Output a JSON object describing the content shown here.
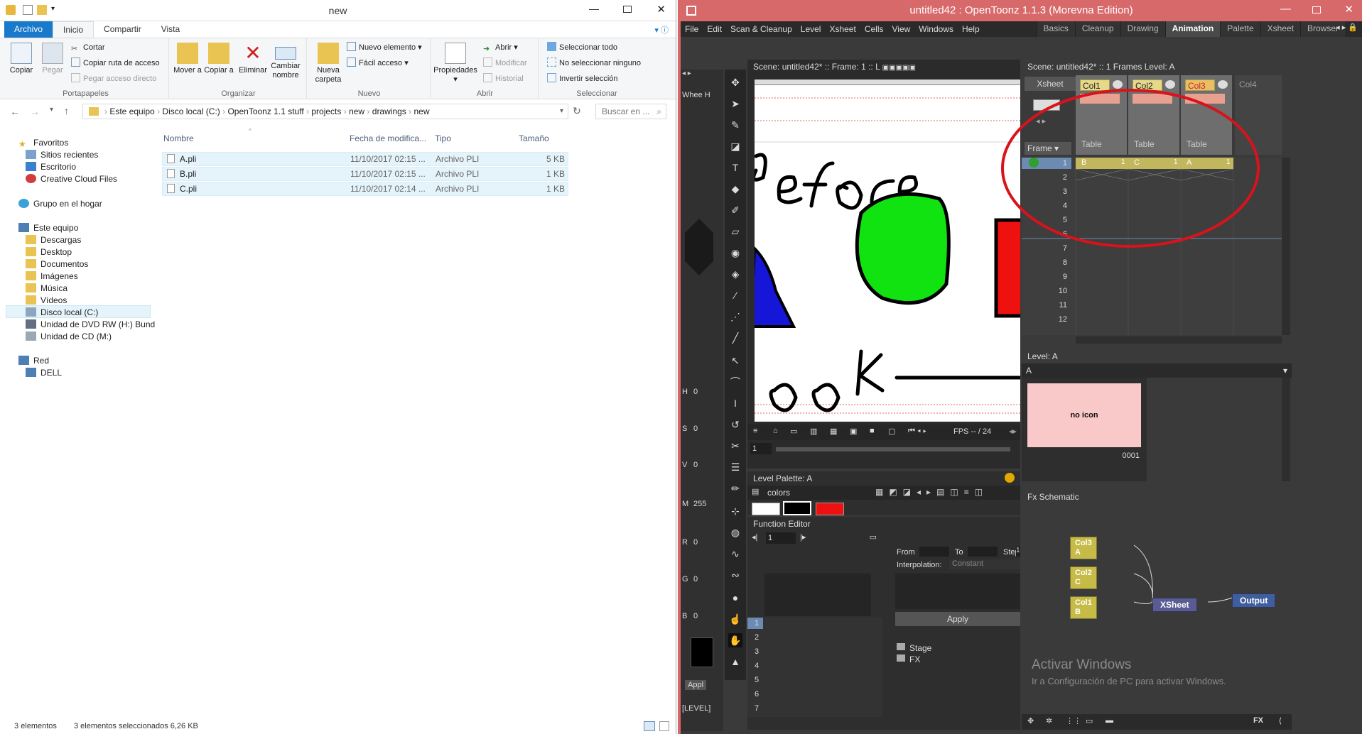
{
  "explorer": {
    "window_title": "new",
    "tabs": [
      {
        "label": "Archivo"
      },
      {
        "label": "Inicio"
      },
      {
        "label": "Compartir"
      },
      {
        "label": "Vista"
      }
    ],
    "ribbon": {
      "clipboard": {
        "copy": "Copiar",
        "paste": "Pegar",
        "cut": "Cortar",
        "copy_path": "Copiar ruta de acceso",
        "paste_shortcut": "Pegar acceso directo",
        "group": "Portapapeles"
      },
      "organize": {
        "move": "Mover a",
        "copy_to": "Copiar a",
        "delete": "Eliminar",
        "rename": "Cambiar nombre",
        "group": "Organizar"
      },
      "new": {
        "new_folder": "Nueva carpeta",
        "new_item": "Nuevo elemento",
        "easy_access": "Fácil acceso",
        "group": "Nuevo"
      },
      "open": {
        "properties": "Propiedades",
        "open": "Abrir",
        "modify": "Modificar",
        "history": "Historial",
        "group": "Abrir"
      },
      "select": {
        "select_all": "Seleccionar todo",
        "select_none": "No seleccionar ninguno",
        "invert": "Invertir selección",
        "group": "Seleccionar"
      }
    },
    "address": {
      "crumbs": [
        "Este equipo",
        "Disco local (C:)",
        "OpenToonz 1.1 stuff",
        "projects",
        "new",
        "drawings",
        "new"
      ],
      "search_placeholder": "Buscar en ..."
    },
    "nav": {
      "favorites": "Favoritos",
      "recent": "Sitios recientes",
      "desktop_fav": "Escritorio",
      "ccfiles": "Creative Cloud Files",
      "homegroup": "Grupo en el hogar",
      "thispc": "Este equipo",
      "downloads": "Descargas",
      "desktop": "Desktop",
      "documents": "Documentos",
      "images": "Imágenes",
      "music": "Música",
      "videos": "Vídeos",
      "local_disk": "Disco local (C:)",
      "dvd": "Unidad de DVD RW (H:) Bund",
      "cd": "Unidad de CD (M:)",
      "network": "Red",
      "dell": "DELL"
    },
    "columns": {
      "name": "Nombre",
      "date": "Fecha de modifica...",
      "type": "Tipo",
      "size": "Tamaño"
    },
    "files": [
      {
        "name": "A.pli",
        "date": "11/10/2017 02:15 ...",
        "type": "Archivo PLI",
        "size": "5 KB"
      },
      {
        "name": "B.pli",
        "date": "11/10/2017 02:15 ...",
        "type": "Archivo PLI",
        "size": "1 KB"
      },
      {
        "name": "C.pli",
        "date": "11/10/2017 02:14 ...",
        "type": "Archivo PLI",
        "size": "1 KB"
      }
    ],
    "status": {
      "count": "3 elementos",
      "selected": "3 elementos seleccionados  6,26 KB"
    }
  },
  "otz": {
    "window_title": "untitled42 : OpenToonz 1.1.3 (Morevna Edition)",
    "menu": [
      "File",
      "Edit",
      "Scan & Cleanup",
      "Level",
      "Xsheet",
      "Cells",
      "View",
      "Windows",
      "Help"
    ],
    "rooms": [
      "Basics",
      "Cleanup",
      "Drawing",
      "Animation",
      "Palette",
      "Xsheet",
      "Browser"
    ],
    "active_room": "Animation",
    "viewer": {
      "scene_label": "Scene: untitled42*  ::  Frame: 1  ::  L",
      "fps": "FPS -- / 24",
      "frame_field": "1"
    },
    "xsheet_header": {
      "label": "Scene: untitled42*  ::  1 Frames  Level: A",
      "tab": "Xsheet",
      "frame_label": "Frame"
    },
    "columns": [
      {
        "name": "Col1",
        "type": "Table",
        "cell": "B",
        "num": "1"
      },
      {
        "name": "Col2",
        "type": "Table",
        "cell": "C",
        "num": "1"
      },
      {
        "name": "Col3",
        "type": "Table",
        "cell": "A",
        "num": "1"
      }
    ],
    "col4": "Col4",
    "rows": [
      "1",
      "2",
      "3",
      "4",
      "5",
      "6",
      "7",
      "8",
      "9",
      "10",
      "11",
      "12"
    ],
    "level_strip": {
      "title": "Level:  A",
      "level": "A",
      "no_icon": "no icon",
      "frame_id": "0001"
    },
    "hsv": [
      {
        "k": "H",
        "v": "0"
      },
      {
        "k": "S",
        "v": "0"
      },
      {
        "k": "V",
        "v": "0"
      },
      {
        "k": "M",
        "v": "255"
      },
      {
        "k": "R",
        "v": "0"
      },
      {
        "k": "G",
        "v": "0"
      },
      {
        "k": "B",
        "v": "0"
      }
    ],
    "side_labels": {
      "wheel": "Whee H",
      "apply": "Appl",
      "level": "[LEVEL]"
    },
    "level_palette": {
      "title": "Level Palette: A",
      "name": "colors"
    },
    "function_editor": {
      "title": "Function Editor",
      "frame": "1",
      "from": "From",
      "to": "To",
      "step": "Step",
      "step_value": "1",
      "interp_label": "Interpolation:",
      "interp_value": "Constant",
      "apply": "Apply",
      "tree_stage": "Stage",
      "tree_fx": "FX",
      "rows": [
        "1",
        "2",
        "3",
        "4",
        "5",
        "6",
        "7"
      ]
    },
    "fx_schematic": {
      "title": "Fx Schematic",
      "nodes": [
        {
          "col": "Col3",
          "lvl": "A"
        },
        {
          "col": "Col2",
          "lvl": "C"
        },
        {
          "col": "Col1",
          "lvl": "B"
        }
      ],
      "xsheet": "XSheet",
      "output": "Output"
    },
    "watermark": {
      "title": "Activar Windows",
      "sub": "Ir a Configuración de PC para activar Windows."
    }
  }
}
